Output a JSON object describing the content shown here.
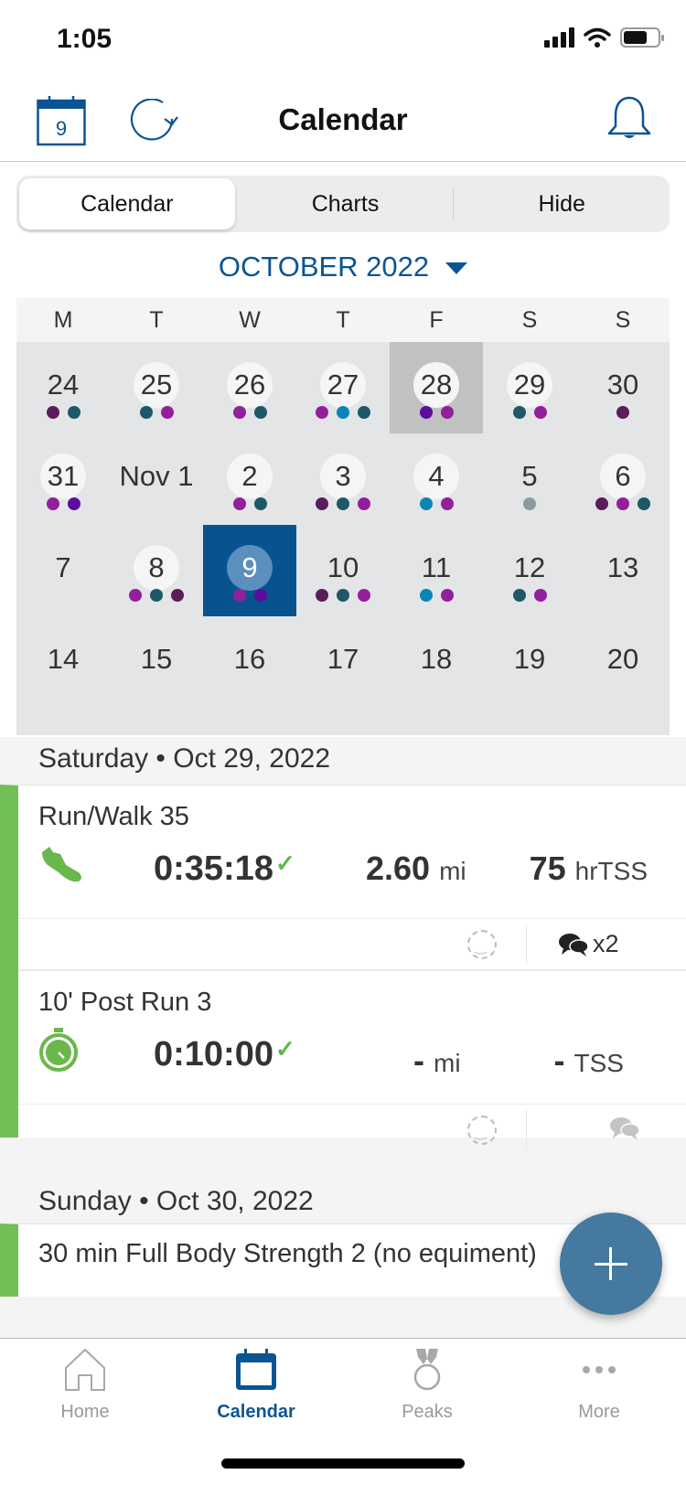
{
  "status_bar": {
    "time": "1:05"
  },
  "header": {
    "title": "Calendar",
    "today_icon_day": "9",
    "icons": [
      "calendar-today-icon",
      "refresh-icon",
      "bell-icon"
    ]
  },
  "segments": {
    "items": [
      "Calendar",
      "Charts",
      "Hide"
    ],
    "active": "Calendar"
  },
  "month_selector": {
    "label": "OCTOBER 2022"
  },
  "calendar": {
    "weekdays": [
      "M",
      "T",
      "W",
      "T",
      "F",
      "S",
      "S"
    ],
    "dot_colors": {
      "plum": "#5a1d5a",
      "teal": "#1d5868",
      "magenta": "#931f9c",
      "violet": "#5c0c9e",
      "cyan": "#0b85b6",
      "gray": "#8a9aa1"
    },
    "weeks": [
      [
        {
          "label": "24",
          "bubble": false,
          "dots": [
            "plum",
            "teal"
          ]
        },
        {
          "label": "25",
          "bubble": true,
          "dots": [
            "teal",
            "magenta"
          ]
        },
        {
          "label": "26",
          "bubble": true,
          "dots": [
            "magenta",
            "teal"
          ]
        },
        {
          "label": "27",
          "bubble": true,
          "dots": [
            "magenta",
            "cyan",
            "teal"
          ]
        },
        {
          "label": "28",
          "bubble": true,
          "today": true,
          "dots": [
            "violet",
            "magenta"
          ]
        },
        {
          "label": "29",
          "bubble": true,
          "dots": [
            "teal",
            "magenta"
          ]
        },
        {
          "label": "30",
          "bubble": false,
          "dots": [
            "plum"
          ]
        }
      ],
      [
        {
          "label": "31",
          "bubble": true,
          "dots": [
            "magenta",
            "violet"
          ]
        },
        {
          "label": "Nov 1",
          "bubble": false,
          "dots": []
        },
        {
          "label": "2",
          "bubble": true,
          "dots": [
            "magenta",
            "teal"
          ]
        },
        {
          "label": "3",
          "bubble": true,
          "dots": [
            "plum",
            "teal",
            "magenta"
          ]
        },
        {
          "label": "4",
          "bubble": true,
          "dots": [
            "cyan",
            "magenta"
          ]
        },
        {
          "label": "5",
          "bubble": false,
          "dots": [
            "gray"
          ]
        },
        {
          "label": "6",
          "bubble": true,
          "dots": [
            "plum",
            "magenta",
            "teal"
          ]
        }
      ],
      [
        {
          "label": "7",
          "bubble": false,
          "dots": []
        },
        {
          "label": "8",
          "bubble": true,
          "dots": [
            "magenta",
            "teal",
            "plum"
          ]
        },
        {
          "label": "9",
          "bubble": true,
          "selected": true,
          "dots": [
            "magenta",
            "violet"
          ]
        },
        {
          "label": "10",
          "bubble": false,
          "dots": [
            "plum",
            "teal",
            "magenta"
          ]
        },
        {
          "label": "11",
          "bubble": false,
          "dots": [
            "cyan",
            "magenta"
          ]
        },
        {
          "label": "12",
          "bubble": false,
          "dots": [
            "teal",
            "magenta"
          ]
        },
        {
          "label": "13",
          "bubble": false,
          "dots": []
        }
      ],
      [
        {
          "label": "14",
          "bubble": false,
          "dots": []
        },
        {
          "label": "15",
          "bubble": false,
          "dots": []
        },
        {
          "label": "16",
          "bubble": false,
          "dots": []
        },
        {
          "label": "17",
          "bubble": false,
          "dots": []
        },
        {
          "label": "18",
          "bubble": false,
          "dots": []
        },
        {
          "label": "19",
          "bubble": false,
          "dots": []
        },
        {
          "label": "20",
          "bubble": false,
          "dots": []
        }
      ]
    ]
  },
  "workout_days": [
    {
      "header": "Saturday • Oct 29, 2022",
      "workouts": [
        {
          "title": "Run/Walk 35",
          "icon": "run-shoe-icon",
          "duration": "0:35:18",
          "completed": true,
          "distance_value": "2.60",
          "distance_unit": "mi",
          "tss_value": "75",
          "tss_unit": "hrTSS",
          "comments_count": "x2"
        },
        {
          "title": "10' Post Run 3",
          "icon": "stopwatch-icon",
          "duration": "0:10:00",
          "completed": true,
          "distance_value": "-",
          "distance_unit": "mi",
          "tss_value": "-",
          "tss_unit": "TSS",
          "comments_count": ""
        }
      ]
    },
    {
      "header": "Sunday • Oct 30, 2022",
      "workouts": [
        {
          "title": "30 min Full Body Strength 2 (no equiment)"
        }
      ]
    }
  ],
  "check_mark": "✓",
  "colors": {
    "brand_blue": "#0a5494",
    "workout_green": "#72bf53",
    "fab_blue": "#45799f"
  },
  "tab_bar": {
    "items": [
      {
        "label": "Home",
        "icon": "home-icon"
      },
      {
        "label": "Calendar",
        "icon": "calendar-icon",
        "active": true
      },
      {
        "label": "Peaks",
        "icon": "medal-icon"
      },
      {
        "label": "More",
        "icon": "more-icon"
      }
    ]
  }
}
